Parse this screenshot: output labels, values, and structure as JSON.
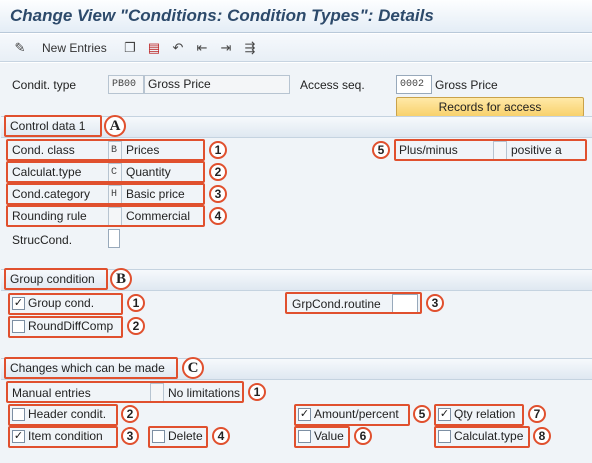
{
  "title": "Change View \"Conditions: Condition Types\": Details",
  "toolbar": {
    "new_entries": "New Entries",
    "icons": [
      "pencil-glasses-icon",
      "copy-icon",
      "delete-icon",
      "undo-icon",
      "first-page-icon",
      "next-page-icon",
      "last-page-icon"
    ]
  },
  "header": {
    "condit_type_label": "Condit. type",
    "condit_type_code": "PB00",
    "condit_type_desc": "Gross Price",
    "access_seq_label": "Access seq.",
    "access_seq_code": "0002",
    "access_seq_desc": "Gross Price",
    "records_button": "Records for access"
  },
  "control": {
    "section_label": "Control data 1",
    "marker": "A",
    "rows": [
      {
        "label": "Cond. class",
        "code": "B",
        "value": "Prices",
        "num": "1"
      },
      {
        "label": "Calculat.type",
        "code": "C",
        "value": "Quantity",
        "num": "2"
      },
      {
        "label": "Cond.category",
        "code": "H",
        "value": "Basic price",
        "num": "3"
      },
      {
        "label": "Rounding rule",
        "code": "",
        "value": "Commercial",
        "num": "4"
      }
    ],
    "struc_label": "StrucCond.",
    "plus_minus_label": "Plus/minus",
    "plus_minus_value": "positive a",
    "plus_minus_num": "5"
  },
  "group": {
    "section_label": "Group condition",
    "marker": "B",
    "group_cond": {
      "label": "Group cond.",
      "checked": true,
      "num": "1"
    },
    "round_diff": {
      "label": "RoundDiffComp",
      "checked": false,
      "num": "2"
    },
    "routine_label": "GrpCond.routine",
    "routine_num": "3"
  },
  "changes": {
    "section_label": "Changes which can be made",
    "marker": "C",
    "manual_label": "Manual entries",
    "manual_value": "No limitations",
    "manual_num": "1",
    "header_condit": {
      "label": "Header condit.",
      "checked": false,
      "num": "2"
    },
    "item_condition": {
      "label": "Item condition",
      "checked": true,
      "num": "3"
    },
    "delete": {
      "label": "Delete",
      "checked": false,
      "num": "4"
    },
    "amount_percent": {
      "label": "Amount/percent",
      "checked": true,
      "num": "5"
    },
    "value": {
      "label": "Value",
      "checked": false,
      "num": "6"
    },
    "qty_relation": {
      "label": "Qty relation",
      "checked": true,
      "num": "7"
    },
    "calculat_type": {
      "label": "Calculat.type",
      "checked": false,
      "num": "8"
    }
  }
}
